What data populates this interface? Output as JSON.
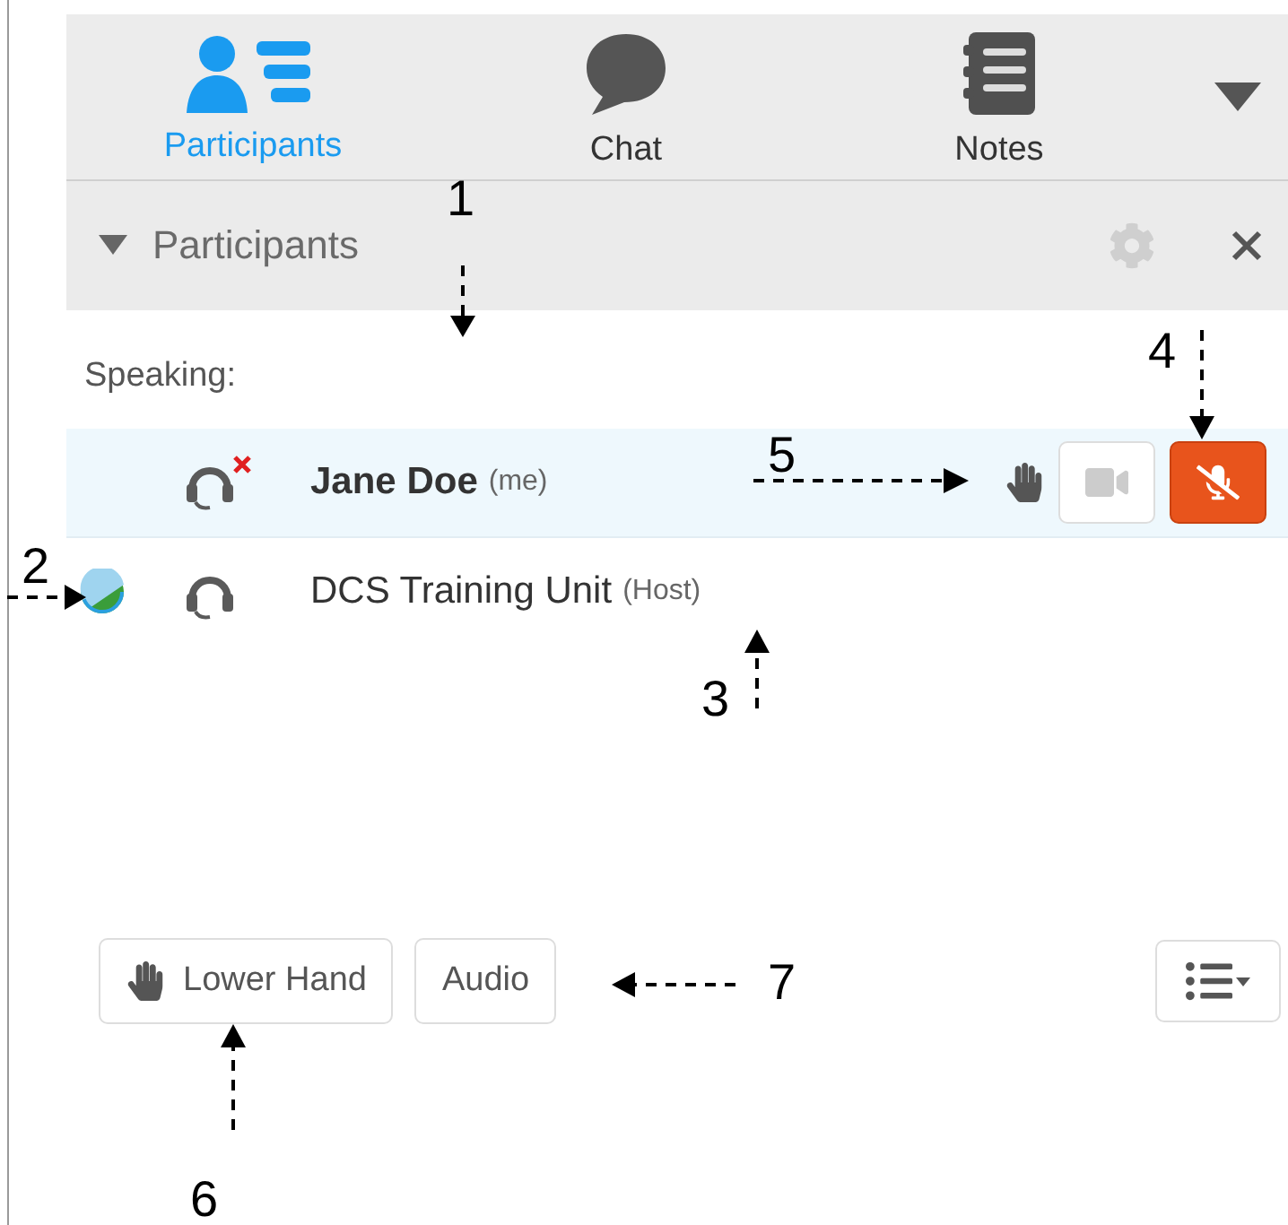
{
  "tabs": [
    {
      "label": "Participants",
      "kind": "participants",
      "selected": true
    },
    {
      "label": "Chat",
      "kind": "chat",
      "selected": false
    },
    {
      "label": "Notes",
      "kind": "notes",
      "selected": false
    }
  ],
  "panel": {
    "title": "Participants",
    "expanded": true
  },
  "section_label": "Speaking:",
  "participants": [
    {
      "name": "Jane Doe",
      "tag": "(me)",
      "selected": true,
      "presence": false,
      "audio_muted": true,
      "controls": {
        "hand_raised": true,
        "video_on": false,
        "mic_muted": true
      }
    },
    {
      "name": "DCS Training Unit",
      "tag": "(Host)",
      "selected": false,
      "presence": true,
      "audio_muted": false
    }
  ],
  "buttons": [
    {
      "label": "Lower Hand",
      "kind": "hand"
    },
    {
      "label": "Audio",
      "kind": "plain"
    }
  ],
  "annotations": [
    {
      "label": "1"
    },
    {
      "label": "2"
    },
    {
      "label": "3"
    },
    {
      "label": "4"
    },
    {
      "label": "5"
    },
    {
      "label": "6"
    },
    {
      "label": "7"
    }
  ]
}
